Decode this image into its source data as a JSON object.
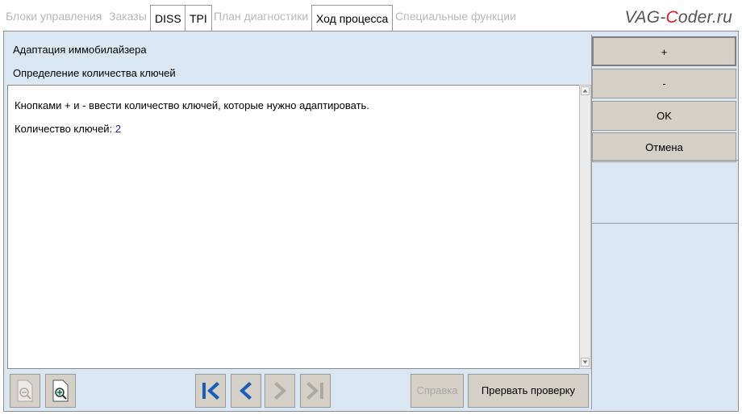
{
  "tabs": [
    {
      "label": "Блоки управления",
      "state": "disabled"
    },
    {
      "label": "Заказы",
      "state": "disabled"
    },
    {
      "label": "DISS",
      "state": "enabled"
    },
    {
      "label": "TPI",
      "state": "enabled"
    },
    {
      "label": "План диагностики",
      "state": "disabled"
    },
    {
      "label": "Ход процесса",
      "state": "active"
    },
    {
      "label": "Специальные функции",
      "state": "disabled"
    }
  ],
  "watermark": {
    "part1": "VAG-",
    "accent": "C",
    "part2": "oder.ru"
  },
  "header": {
    "title": "Адаптация иммобилайзера",
    "subtitle": "Определение количества ключей"
  },
  "content": {
    "instruction": "Кнопками + и - ввести количество ключей, которые нужно адаптировать.",
    "keys_label": "Количество ключей:",
    "keys_value": "2"
  },
  "side_buttons": {
    "plus": "+",
    "minus": "-",
    "ok": "OK",
    "cancel": "Отмена"
  },
  "toolbar": {
    "zoom_out_icon": "zoom-out-icon",
    "zoom_in_icon": "zoom-in-icon",
    "first_icon": "skip-to-first-icon",
    "back_icon": "back-arrow-icon",
    "forward_icon": "forward-arrow-icon",
    "last_icon": "skip-to-last-icon",
    "help_label": "Справка",
    "abort_label": "Прервать проверку"
  },
  "colors": {
    "panel": "#dbe6f3",
    "button": "#d4d0c8",
    "nav_active": "#1a5fb4",
    "value": "#2020b0"
  }
}
